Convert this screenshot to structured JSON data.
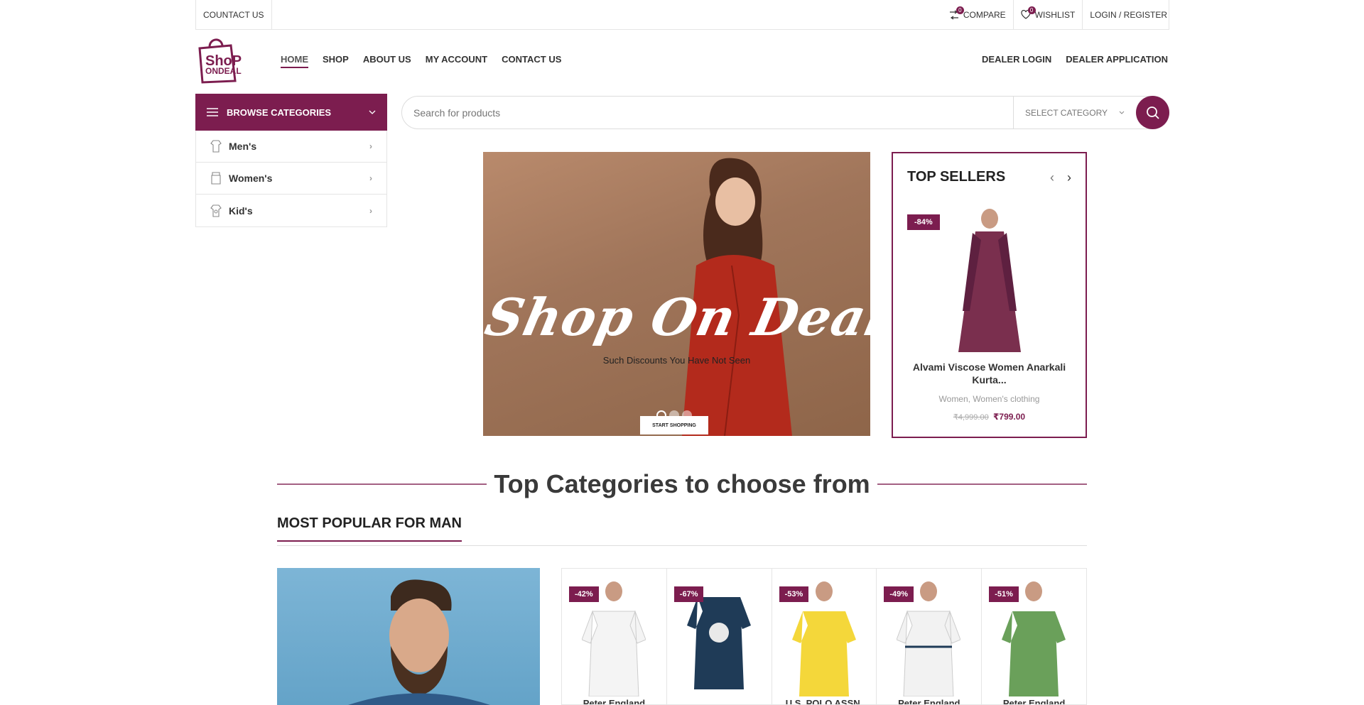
{
  "topbar": {
    "contact": "COUNTACT US",
    "compare": "COMPARE",
    "compare_count": "0",
    "wishlist": "WISHLIST",
    "wishlist_count": "0",
    "login": "LOGIN / REGISTER"
  },
  "header": {
    "logo_line1": "ShoP",
    "logo_line2": "ONDEAL",
    "nav": [
      "HOME",
      "SHOP",
      "ABOUT US",
      "MY ACCOUNT",
      "CONTACT US"
    ],
    "dealer": [
      "DEALER LOGIN",
      "DEALER APPLICATION"
    ]
  },
  "categories": {
    "title": "BROWSE CATEGORIES",
    "items": [
      {
        "label": "Men's",
        "icon": "shirt-icon"
      },
      {
        "label": "Women's",
        "icon": "dress-icon"
      },
      {
        "label": "Kid's",
        "icon": "kids-shirt-icon"
      }
    ]
  },
  "search": {
    "placeholder": "Search for products",
    "category": "SELECT CATEGORY"
  },
  "hero": {
    "script": "Shop On Deal",
    "tagline": "Such Discounts You Have Not Seen",
    "cta": "START SHOPPING"
  },
  "sellers": {
    "title": "TOP SELLERS",
    "discount": "-84%",
    "name": "Alvami Viscose Women Anarkali Kurta...",
    "cats": "Women, Women's clothing",
    "old_price": "₹4,999.00",
    "new_price": "₹799.00"
  },
  "section": {
    "title": "Top Categories to choose from",
    "subtitle": "MOST POPULAR FOR MAN"
  },
  "products": [
    {
      "discount": "-42%",
      "name": "Peter England",
      "color": "#f4f4f4"
    },
    {
      "discount": "-67%",
      "name": "",
      "color": "#1f3b57"
    },
    {
      "discount": "-53%",
      "name": "U.S. POLO ASSN.",
      "color": "#f4d73a"
    },
    {
      "discount": "-49%",
      "name": "Peter England",
      "color": "#f2f2f2"
    },
    {
      "discount": "-51%",
      "name": "Peter England",
      "color": "#6aa05a"
    }
  ],
  "colors": {
    "accent": "#7c1d4f"
  }
}
